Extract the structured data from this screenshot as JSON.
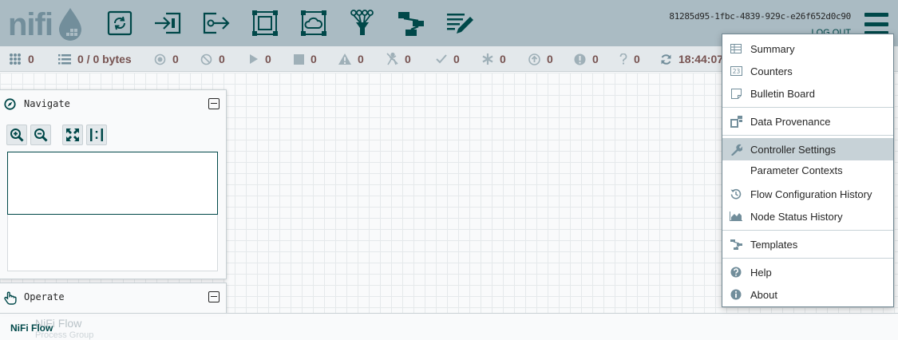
{
  "header": {
    "logo_text": "nifi",
    "user_identity": "81285d95-1fbc-4839-929c-e26f652d0c90",
    "logout_label": "LOG OUT",
    "toolbar": [
      "processor-icon",
      "input-port-icon",
      "output-port-icon",
      "process-group-icon",
      "remote-process-group-icon",
      "funnel-icon",
      "template-icon",
      "label-icon"
    ]
  },
  "status_bar": {
    "cluster_nodes": "0",
    "queued": "0 / 0 bytes",
    "transmitting": "0",
    "not_transmitting": "0",
    "running": "0",
    "stopped": "0",
    "invalid": "0",
    "disabled": "0",
    "up_to_date": "0",
    "locally_modified": "0",
    "stale": "0",
    "locally_modified_and_stale": "0",
    "sync_failure": "0",
    "last_refreshed": "18:44:07"
  },
  "navigate": {
    "title": "Navigate"
  },
  "operate": {
    "title": "Operate",
    "selection_name": "NiFi Flow",
    "selection_type": "Process Group"
  },
  "breadcrumb": {
    "root": "NiFi Flow"
  },
  "menu": {
    "summary": "Summary",
    "counters": "Counters",
    "bulletin_board": "Bulletin Board",
    "data_provenance": "Data Provenance",
    "controller_settings": "Controller Settings",
    "parameter_contexts": "Parameter Contexts",
    "flow_configuration_history": "Flow Configuration History",
    "node_status_history": "Node Status History",
    "templates": "Templates",
    "help": "Help",
    "about": "About",
    "active_item": "Controller Settings"
  },
  "colors": {
    "header_bg": "#aabbc3",
    "accent": "#004849",
    "status_value": "#775351",
    "menu_highlight": "#c7d2d7"
  }
}
